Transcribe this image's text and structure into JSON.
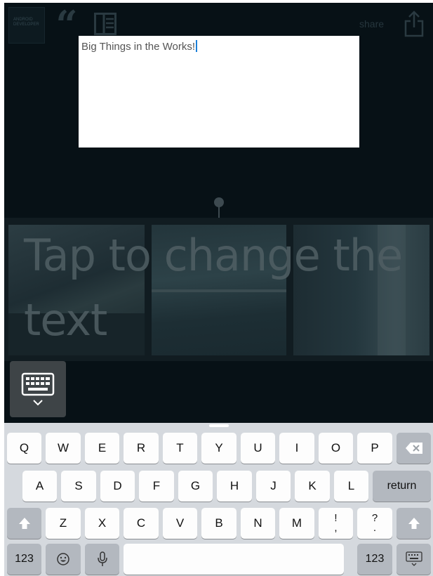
{
  "toolbar": {
    "logo_text": "ANDROID DEVELOPER",
    "share_label": "share"
  },
  "editor": {
    "text_value": "Big Things in the Works!"
  },
  "strip": {
    "overlay_text": "Tap to change the text"
  },
  "keyboard": {
    "row1": [
      "Q",
      "W",
      "E",
      "R",
      "T",
      "Y",
      "U",
      "I",
      "O",
      "P"
    ],
    "row2": [
      "A",
      "S",
      "D",
      "F",
      "G",
      "H",
      "J",
      "K",
      "L"
    ],
    "row3": [
      "Z",
      "X",
      "C",
      "V",
      "B",
      "N",
      "M"
    ],
    "return_label": "return",
    "numbers_label_left": "123",
    "numbers_label_right": "123",
    "exclaim_top": "!",
    "exclaim_bottom": ",",
    "question_top": "?",
    "question_bottom": "."
  },
  "colors": {
    "background": "#071116",
    "keyboard_bg": "#d5d9de",
    "key": "#fdfdfd",
    "key_dark": "#b3b8bf",
    "caret": "#1b7fd8"
  }
}
